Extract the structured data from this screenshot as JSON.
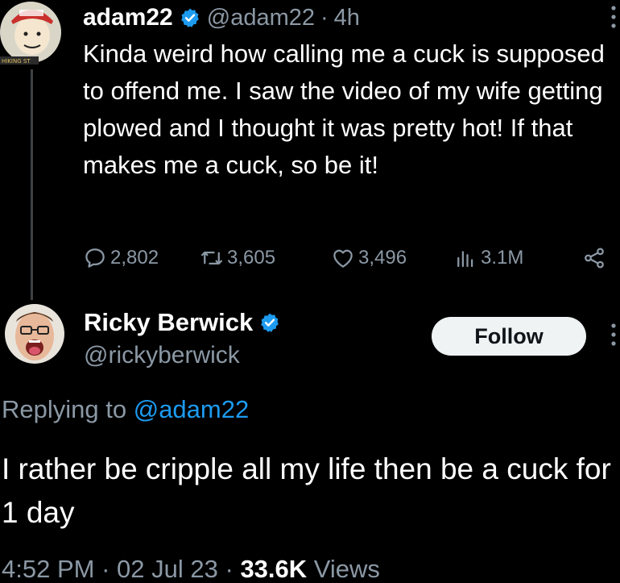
{
  "tweet": {
    "author_name": "adam22",
    "author_handle": "@adam22",
    "separator": "·",
    "time_ago": "4h",
    "text": "Kinda weird how calling me a cuck is supposed to offend me. I saw the video of my wife getting plowed and I thought it was pretty hot! If that makes me a cuck, so be it!",
    "avatar_badge_text": "HIKING ST",
    "replies": "2,802",
    "retweets": "3,605",
    "likes": "3,496",
    "views": "3.1M"
  },
  "reply": {
    "author_name": "Ricky Berwick",
    "author_handle": "@rickyberwick",
    "follow_label": "Follow",
    "replying_prefix": "Replying to",
    "replying_to": "@adam22",
    "text": "I rather be cripple all my life then be a cuck for 1 day",
    "time": "4:52 PM",
    "date": "02 Jul 23",
    "views_count": "33.6K",
    "views_label": "Views",
    "sep": "·"
  },
  "colors": {
    "background": "#000000",
    "text_primary": "#e7e9ea",
    "text_secondary": "#8b98a5",
    "verified_blue": "#1d9bf0",
    "follow_bg": "#eff3f4"
  },
  "icons": [
    "verified-badge-icon",
    "more-dots-icon",
    "reply-bubble-icon",
    "retweet-icon",
    "heart-icon",
    "views-chart-icon",
    "share-icon"
  ]
}
